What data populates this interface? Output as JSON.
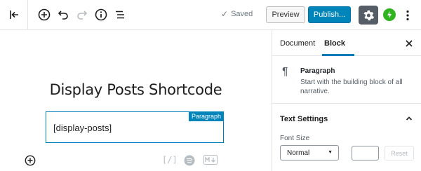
{
  "toolbar": {
    "back_icon": "exit-icon",
    "add_block_icon": "plus-circle-icon",
    "undo_icon": "undo-icon",
    "redo_icon": "redo-icon",
    "info_icon": "info-icon",
    "outline_icon": "list-icon",
    "saved_label": "Saved",
    "preview_label": "Preview",
    "publish_label": "Publish...",
    "settings_icon": "gear-icon",
    "jetpack_icon": "jetpack-icon",
    "more_icon": "more-vertical-icon"
  },
  "editor": {
    "title": "Display Posts Shortcode",
    "block": {
      "type_label": "Paragraph",
      "content": "[display-posts]"
    },
    "footer_icons": [
      "shortcode-icon",
      "spotify-icon",
      "markdown-icon"
    ]
  },
  "sidebar": {
    "tabs": [
      {
        "label": "Document",
        "active": false
      },
      {
        "label": "Block",
        "active": true
      }
    ],
    "close_icon": "close-icon",
    "block_card": {
      "icon": "paragraph-icon",
      "title": "Paragraph",
      "description": "Start with the building block of all narrative."
    },
    "text_settings": {
      "title": "Text Settings",
      "font_size_label": "Font Size",
      "font_size_value": "Normal",
      "custom_value": "",
      "reset_label": "Reset"
    }
  },
  "colors": {
    "accent": "#0085ba",
    "settings_active_bg": "#555d66",
    "jetpack_green": "#2fb41f"
  }
}
